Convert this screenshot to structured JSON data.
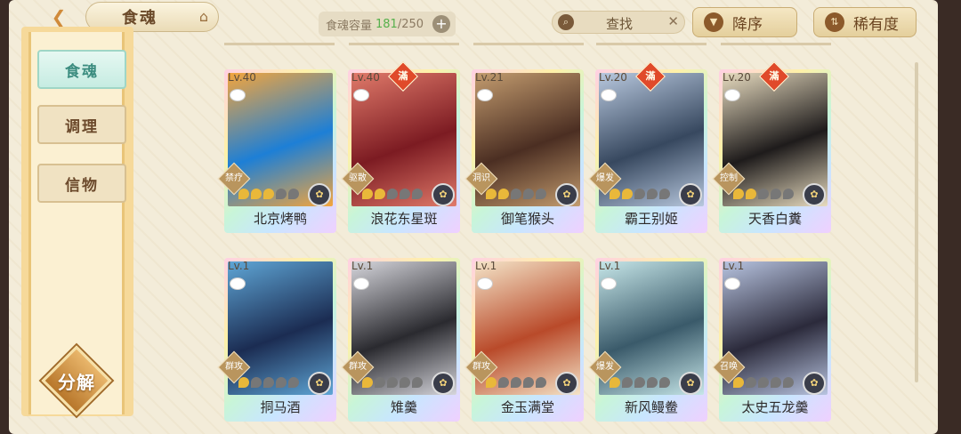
{
  "header": {
    "title": "食魂",
    "capacity_label": "食魂容量",
    "capacity_current": "181",
    "capacity_max": "/250",
    "search_label": "查找",
    "sort_label": "降序",
    "rarity_label": "稀有度"
  },
  "sidebar": {
    "items": [
      {
        "label": "食魂"
      },
      {
        "label": "调理"
      },
      {
        "label": "信物"
      }
    ],
    "decompose": "分解"
  },
  "cards": [
    {
      "level": "Lv.40",
      "name": "北京烤鸭",
      "role": "禁疗",
      "full": false,
      "stars": 3,
      "grad": [
        "#1d7fd6",
        "#f4a53c"
      ]
    },
    {
      "level": "Lv.40",
      "name": "浪花东星斑",
      "role": "驱散",
      "full": true,
      "stars": 2,
      "grad": [
        "#7c1b22",
        "#e07a6a"
      ]
    },
    {
      "level": "Lv.21",
      "name": "御笔猴头",
      "role": "洞识",
      "full": false,
      "stars": 2,
      "grad": [
        "#4b2e22",
        "#c39c6f"
      ]
    },
    {
      "level": "Lv.20",
      "name": "霸王别姬",
      "role": "爆发",
      "full": true,
      "stars": 2,
      "grad": [
        "#37485f",
        "#b8c8de"
      ]
    },
    {
      "level": "Lv.20",
      "name": "天香白糞",
      "role": "控制",
      "full": true,
      "stars": 2,
      "grad": [
        "#1e1b1b",
        "#e8dcc0"
      ]
    },
    {
      "level": "Lv.1",
      "name": "挏马酒",
      "role": "群攻",
      "full": false,
      "stars": 1,
      "grad": [
        "#1b2c52",
        "#5fa6d6"
      ]
    },
    {
      "level": "Lv.1",
      "name": "雉羹",
      "role": "群攻",
      "full": false,
      "stars": 1,
      "grad": [
        "#2a2a2f",
        "#d6d6dc"
      ]
    },
    {
      "level": "Lv.1",
      "name": "金玉满堂",
      "role": "群攻",
      "full": false,
      "stars": 1,
      "grad": [
        "#b94a2a",
        "#f4e4c8"
      ]
    },
    {
      "level": "Lv.1",
      "name": "新风鳗鲞",
      "role": "爆发",
      "full": false,
      "stars": 1,
      "grad": [
        "#3a5a6a",
        "#c6e6e8"
      ]
    },
    {
      "level": "Lv.1",
      "name": "太史五龙羹",
      "role": "召唤",
      "full": false,
      "stars": 1,
      "grad": [
        "#2b2a3b",
        "#b8c4e0"
      ]
    }
  ]
}
